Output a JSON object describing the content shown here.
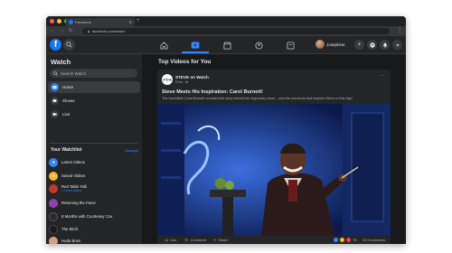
{
  "browser": {
    "tab_title": "Facebook",
    "url": "facebook.com/watch"
  },
  "header": {
    "logo": "f",
    "profile_name": "Josephine",
    "nav_icons": [
      "home-icon",
      "watch-icon",
      "marketplace-icon",
      "groups-icon",
      "gaming-icon"
    ],
    "active_nav": "watch-icon",
    "accent": "#2d88ff"
  },
  "sidebar": {
    "title": "Watch",
    "search_placeholder": "Search Watch",
    "items": [
      {
        "label": "Home",
        "icon": "play-icon"
      },
      {
        "label": "Shows",
        "icon": "tv-icon"
      },
      {
        "label": "Live",
        "icon": "live-icon"
      }
    ],
    "watchlist": {
      "title": "Your Watchlist",
      "manage": "Manage",
      "items": [
        {
          "label": "Latest Videos",
          "sub": ""
        },
        {
          "label": "Saved Videos",
          "sub": ""
        },
        {
          "label": "Red Table Talk",
          "sub": "• 2 new videos"
        },
        {
          "label": "Returning the Favor",
          "sub": ""
        },
        {
          "label": "8 Months with Courteney Cox",
          "sub": ""
        },
        {
          "label": "The Birch",
          "sub": ""
        },
        {
          "label": "Huda Boss",
          "sub": ""
        }
      ]
    }
  },
  "main": {
    "title": "Top Videos for You",
    "post": {
      "page_name": "STEVE on Watch",
      "time": "9 hrs · ⊕",
      "title": "Steve Meets His Inspiration: Carol Burnett!",
      "description": "The incredible Carol Burnett revealed the story behind her legendary show – and the moments that inspired Steve to this day!",
      "actions": {
        "like": "Like",
        "comment": "Comment",
        "share": "Share"
      },
      "reaction_count": "7K",
      "comment_count": "23 Comments"
    }
  }
}
